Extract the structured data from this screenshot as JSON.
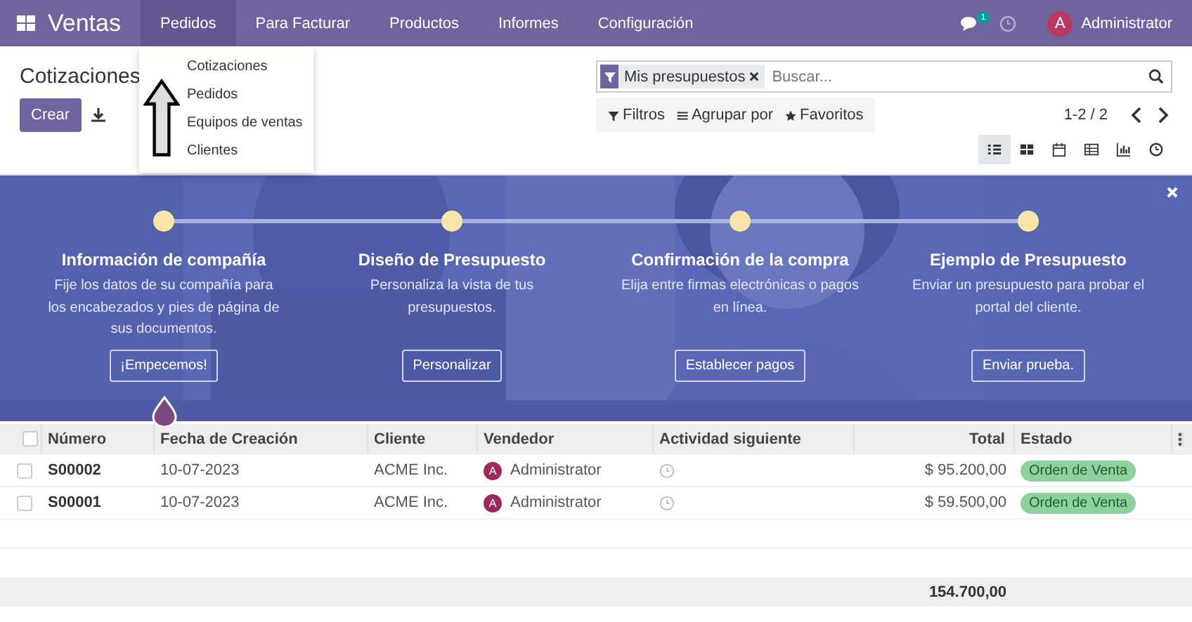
{
  "navbar": {
    "app_name": "Ventas",
    "menu": [
      {
        "label": "Pedidos",
        "selected": true
      },
      {
        "label": "Para Facturar",
        "selected": false
      },
      {
        "label": "Productos",
        "selected": false
      },
      {
        "label": "Informes",
        "selected": false
      },
      {
        "label": "Configuración",
        "selected": false
      }
    ],
    "messages_badge": "1",
    "avatar_letter": "A",
    "user": "Administrator"
  },
  "dropdown": {
    "items": [
      "Cotizaciones",
      "Pedidos",
      "Equipos de ventas",
      "Clientes"
    ]
  },
  "control_panel": {
    "breadcrumb": "Cotizaciones",
    "create_button": "Crear",
    "search": {
      "facet": "Mis presupuestos",
      "placeholder": "Buscar..."
    },
    "filters": [
      {
        "kind": "filter",
        "label": "Filtros"
      },
      {
        "kind": "group",
        "label": "Agrupar por"
      },
      {
        "kind": "star",
        "label": "Favoritos"
      }
    ],
    "pager": "1-2 / 2",
    "views": [
      {
        "kind": "list",
        "selected": true
      },
      {
        "kind": "kanban",
        "selected": false
      },
      {
        "kind": "calendar",
        "selected": false
      },
      {
        "kind": "pivot",
        "selected": false
      },
      {
        "kind": "graph",
        "selected": false
      },
      {
        "kind": "activity",
        "selected": false
      }
    ]
  },
  "banner": {
    "kind": "picture",
    "steps": [
      {
        "title": "Información de compañía",
        "text": "Fije los datos de su compañía para los encabezados y pies de página de sus documentos.",
        "button": "¡Empecemos!"
      },
      {
        "title": "Diseño de Presupuesto",
        "text": "Personaliza la vista de tus presupuestos.",
        "button": "Personalizar"
      },
      {
        "title": "Confirmación de la compra",
        "text": "Elija entre firmas electrónicas o pagos en línea.",
        "button": "Establecer pagos"
      },
      {
        "title": "Ejemplo de Presupuesto",
        "text": "Enviar un presupuesto para probar el portal del cliente.",
        "button": "Enviar prueba."
      }
    ]
  },
  "table": {
    "select_all_checked": false,
    "columns": [
      "Número",
      "Fecha de Creación",
      "Cliente",
      "Vendedor",
      "Actividad siguiente",
      "Total",
      "Estado"
    ],
    "rows": [
      {
        "checked": false,
        "number": "S00002",
        "date": "10-07-2023",
        "client": "ACME Inc.",
        "seller_letter": "A",
        "seller": "Administrator",
        "total": "$ 95.200,00",
        "status": {
          "label": "Orden de Venta",
          "color": "#8fd19e"
        }
      },
      {
        "checked": false,
        "number": "S00001",
        "date": "10-07-2023",
        "client": "ACME Inc.",
        "seller_letter": "A",
        "seller": "Administrator",
        "total": "$ 59.500,00",
        "status": {
          "label": "Orden de Venta",
          "color": "#8fd19e"
        }
      }
    ],
    "footer_total": "154.700,00"
  }
}
